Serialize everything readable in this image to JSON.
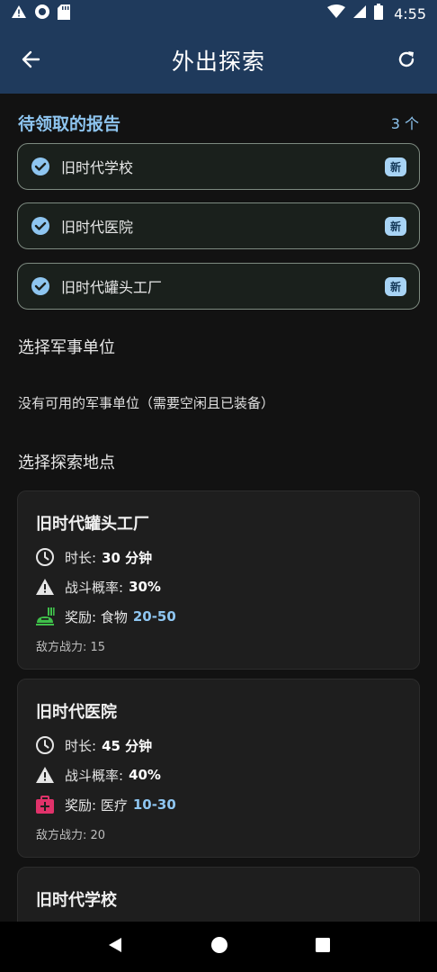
{
  "status_bar": {
    "time": "4:55"
  },
  "app_bar": {
    "title": "外出探索"
  },
  "reports": {
    "title": "待领取的报告",
    "count": "3 个",
    "items": [
      {
        "label": "旧时代学校",
        "badge": "新"
      },
      {
        "label": "旧时代医院",
        "badge": "新"
      },
      {
        "label": "旧时代罐头工厂",
        "badge": "新"
      }
    ]
  },
  "units": {
    "title": "选择军事单位",
    "empty_text": "没有可用的军事单位（需要空闲且已装备）"
  },
  "locations": {
    "title": "选择探索地点",
    "items": [
      {
        "name": "旧时代罐头工厂",
        "duration_label": "时长:",
        "duration": "30 分钟",
        "combat_label": "战斗概率:",
        "combat": "30%",
        "reward_label": "奖励: 食物",
        "reward_range": "20-50",
        "reward_icon": "food-icon",
        "reward_icon_color": "#3fbf4a",
        "enemy": "敌方战力: 15"
      },
      {
        "name": "旧时代医院",
        "duration_label": "时长:",
        "duration": "45 分钟",
        "combat_label": "战斗概率:",
        "combat": "40%",
        "reward_label": "奖励: 医疗",
        "reward_range": "10-30",
        "reward_icon": "medkit-icon",
        "reward_icon_color": "#e0326a",
        "enemy": "敌方战力: 20"
      },
      {
        "name": "旧时代学校"
      }
    ]
  },
  "colors": {
    "app_bar": "#1f3a5c",
    "accent": "#8ec5f0",
    "background": "#121212"
  }
}
